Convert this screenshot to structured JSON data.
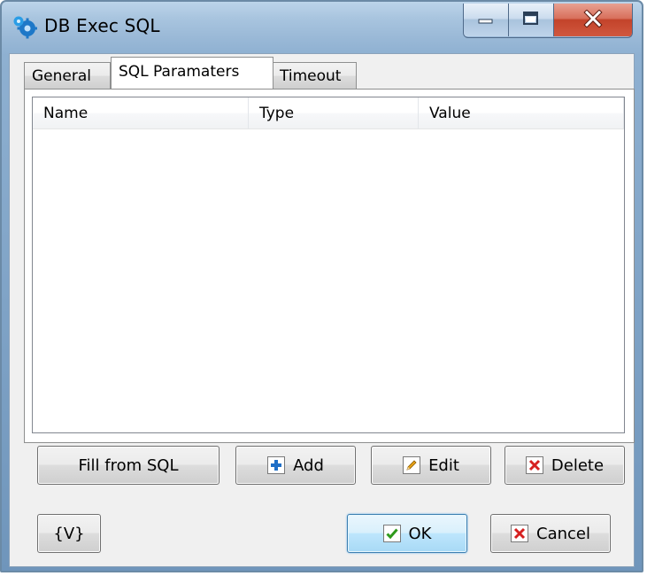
{
  "window": {
    "title": "DB Exec SQL",
    "icon": "gears-icon",
    "controls": [
      "minimize-icon",
      "maximize-icon",
      "close-icon"
    ]
  },
  "tabs": [
    {
      "label": "General",
      "active": false
    },
    {
      "label": "SQL Paramaters",
      "active": true
    },
    {
      "label": "Timeout",
      "active": false
    }
  ],
  "table": {
    "columns": [
      "Name",
      "Type",
      "Value"
    ],
    "rows": []
  },
  "actions": {
    "fill_label": "Fill from SQL",
    "add_label": "Add",
    "edit_label": "Edit",
    "delete_label": "Delete"
  },
  "footer": {
    "variables_label": "{V}",
    "ok_label": "OK",
    "cancel_label": "Cancel"
  },
  "colors": {
    "frame": "#9ab9d7",
    "close_button": "#c3432a",
    "ok_focus": "#3c7fb1",
    "add_icon": "#1f6fc7",
    "check_icon": "#2e9a1c",
    "delete_icon": "#d62020",
    "edit_icon": "#e8a317"
  }
}
